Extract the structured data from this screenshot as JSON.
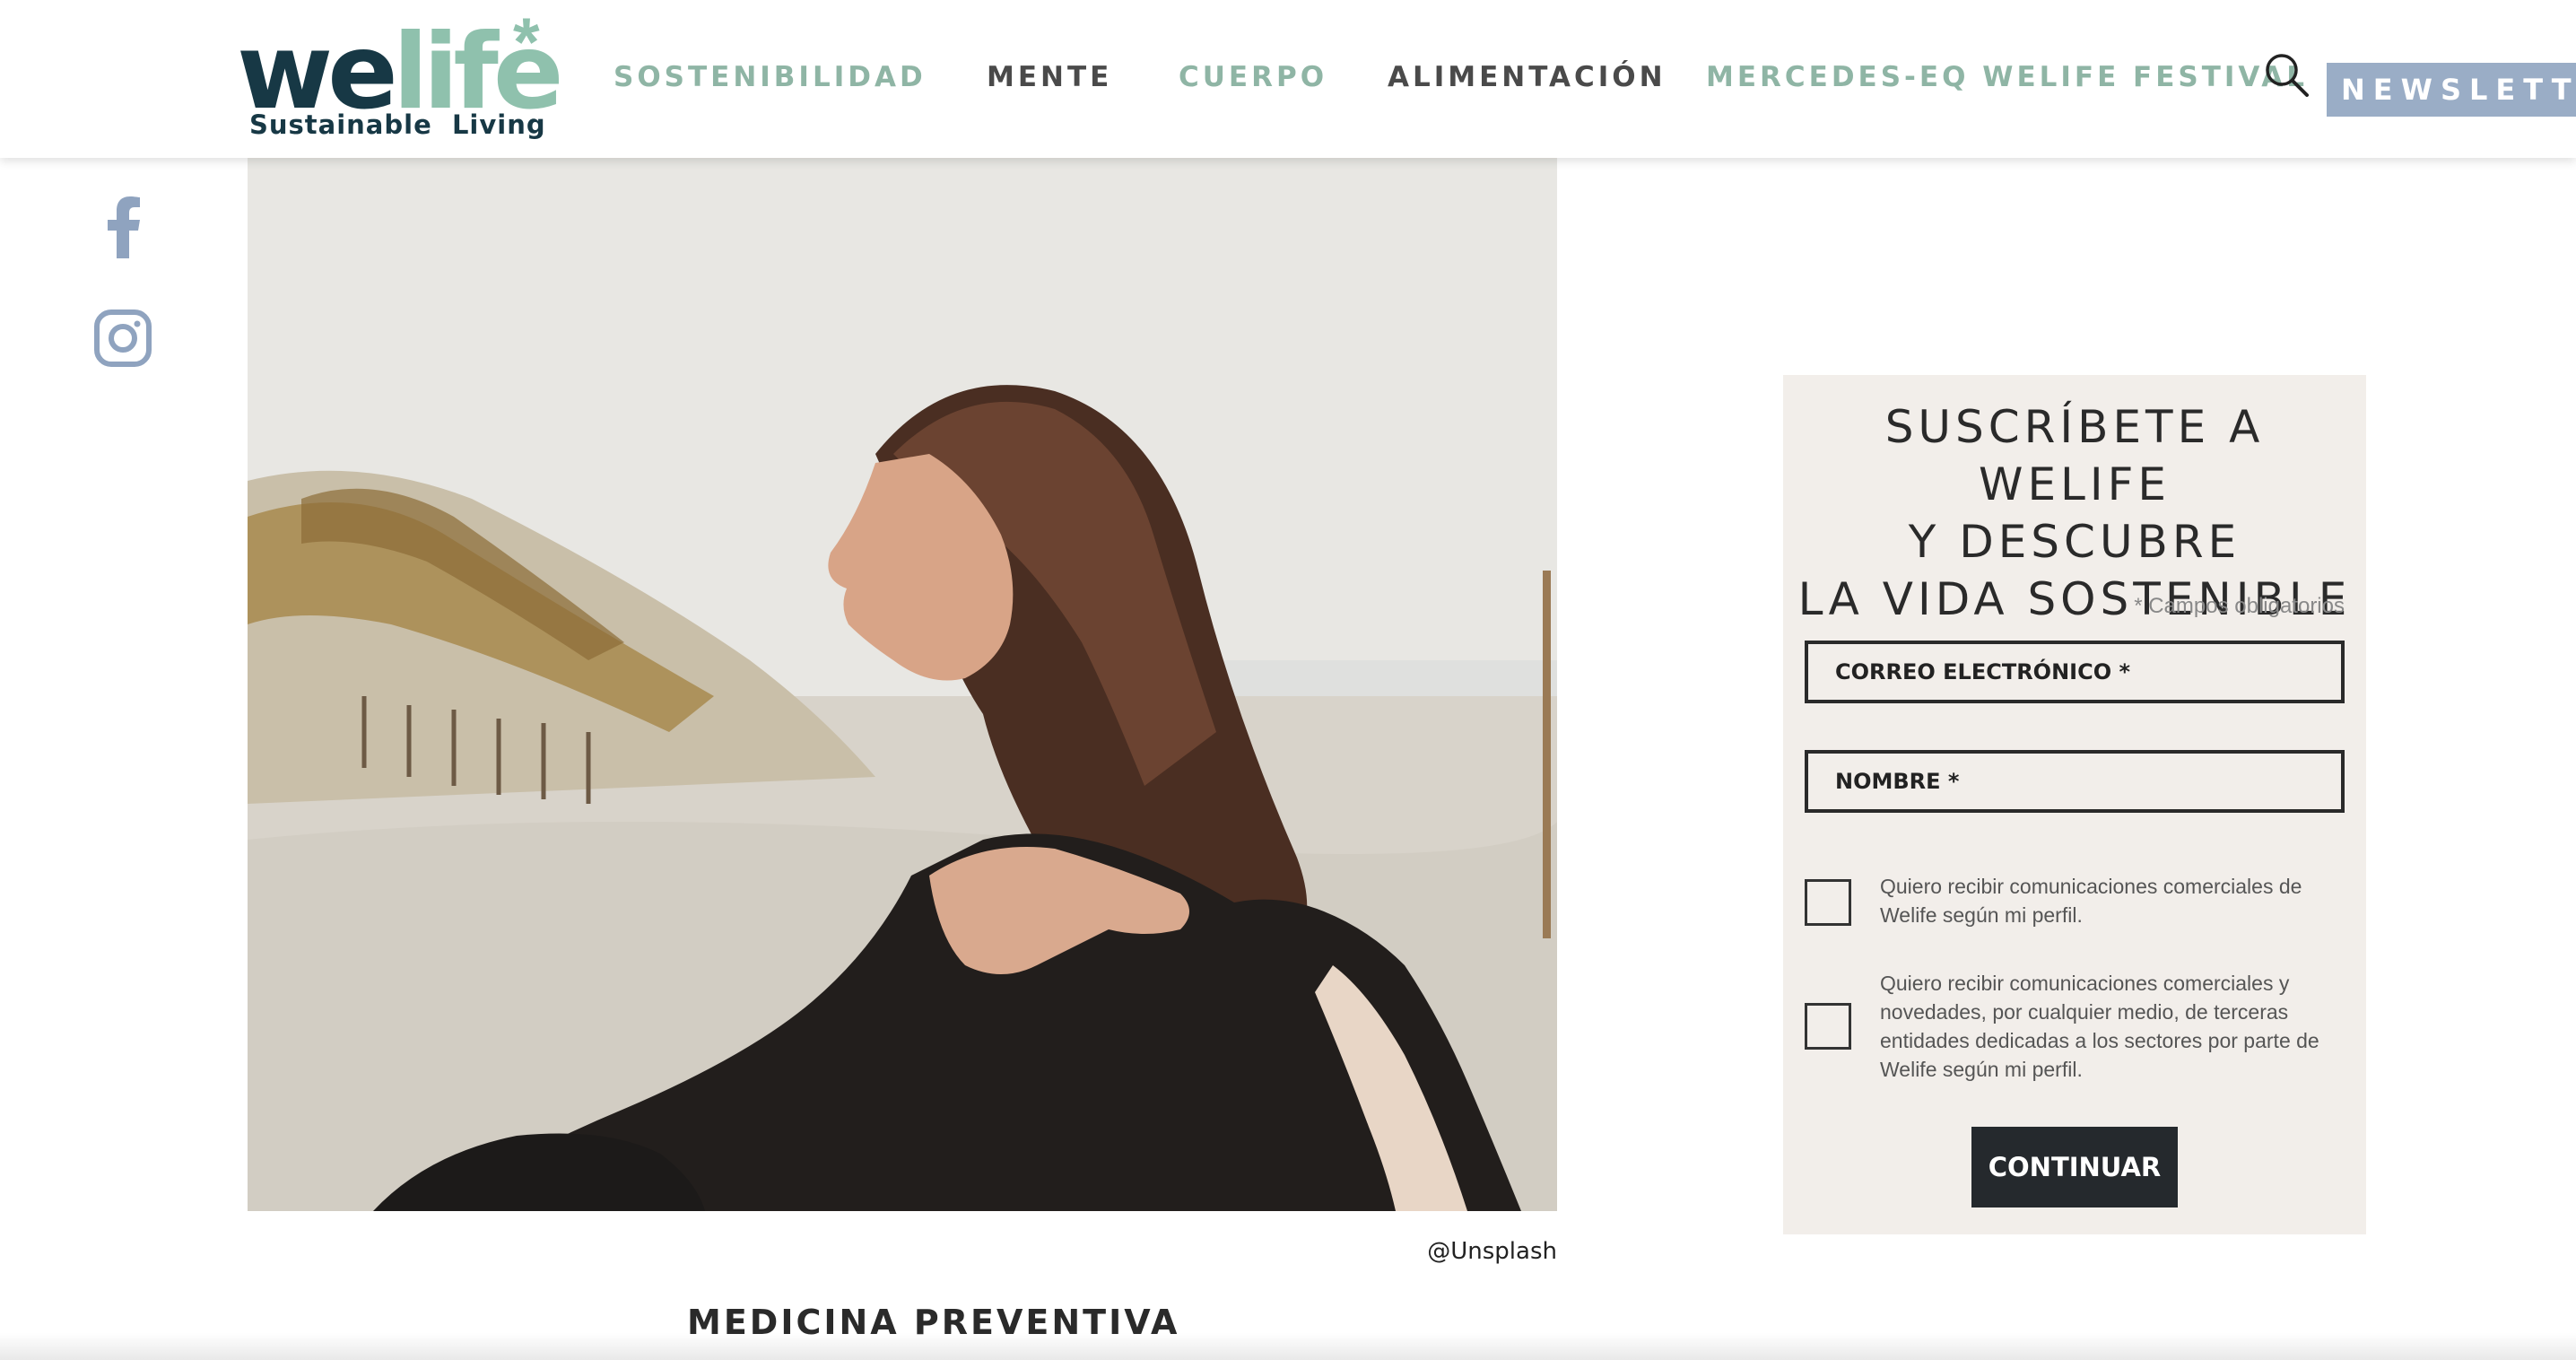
{
  "header": {
    "logo": {
      "word_we": "we",
      "word_life": "life",
      "tagline": "Sustainable  Living"
    },
    "nav": [
      {
        "label": "SOSTENIBILIDAD",
        "style": "green"
      },
      {
        "label": "MENTE",
        "style": "dark"
      },
      {
        "label": "CUERPO",
        "style": "green"
      },
      {
        "label": "ALIMENTACIÓN",
        "style": "dark"
      },
      {
        "label": "MERCEDES-EQ WELIFE FESTIVAL",
        "style": "green"
      }
    ],
    "search_icon": "search-icon",
    "newsletter_label": "NEWSLETTER"
  },
  "social": {
    "icons": [
      "facebook-icon",
      "instagram-icon"
    ]
  },
  "hero": {
    "credit": "@Unsplash"
  },
  "article": {
    "heading": "MEDICINA PREVENTIVA"
  },
  "subscribe": {
    "title_lines": [
      "SUSCRÍBETE A WELIFE",
      "Y DESCUBRE",
      "LA VIDA SOSTENIBLE"
    ],
    "required_note": "* Campos obligatorios",
    "email_placeholder": "CORREO ELECTRÓNICO *",
    "name_placeholder": "NOMBRE *",
    "consent_1": "Quiero recibir comunicaciones comerciales de Welife según mi perfil.",
    "consent_2": "Quiero recibir comunicaciones comerciales y novedades, por cualquier medio, de terceras entidades dedicadas a los sectores por parte de Welife según mi perfil.",
    "submit_label": "CONTINUAR"
  },
  "colors": {
    "brand_dark": "#173845",
    "brand_green": "#8fc1ad",
    "nav_green": "#8fb5a5",
    "newsletter_bg": "#9aadc6",
    "panel_bg": "#f2eeea",
    "button_dark": "#25292d"
  }
}
